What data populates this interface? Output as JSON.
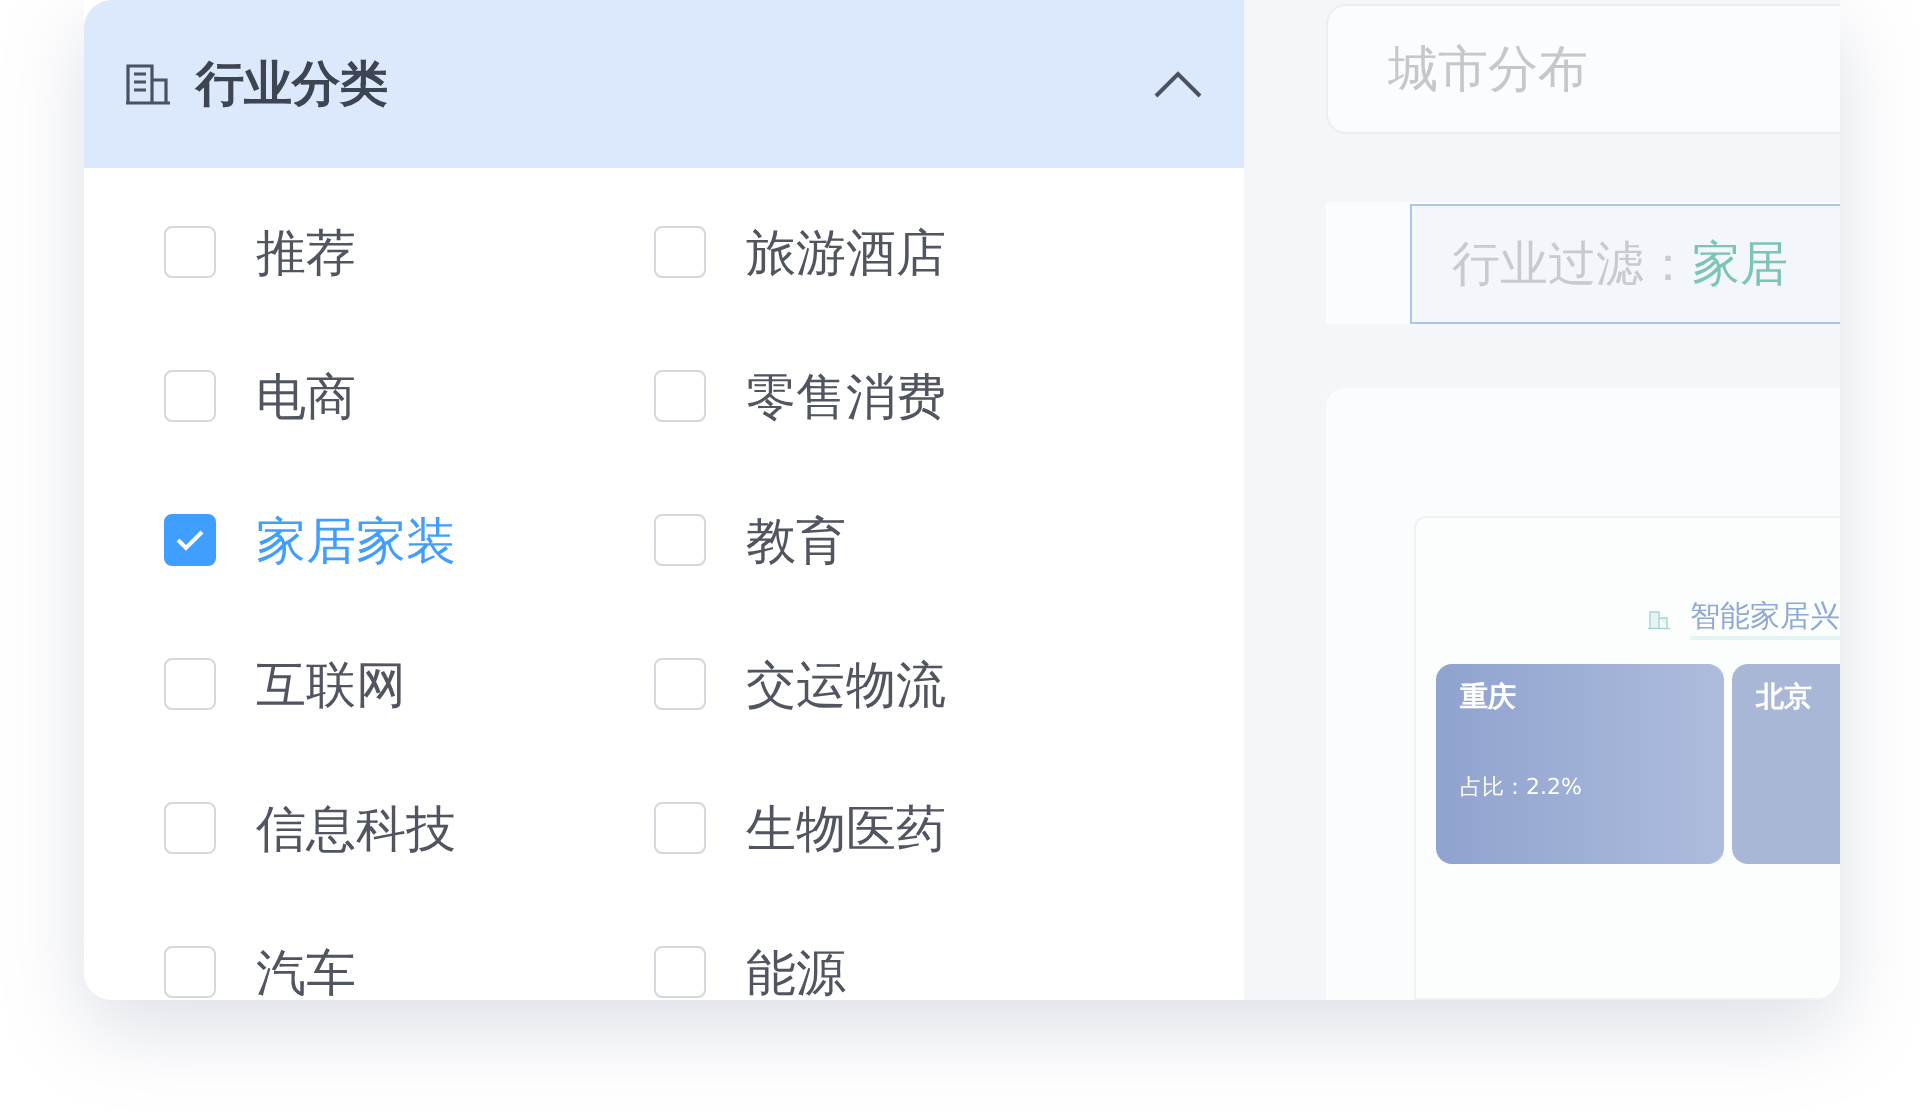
{
  "category_panel": {
    "title": "行业分类",
    "expanded": true,
    "options": [
      {
        "label": "推荐",
        "checked": false
      },
      {
        "label": "旅游酒店",
        "checked": false
      },
      {
        "label": "电商",
        "checked": false
      },
      {
        "label": "零售消费",
        "checked": false
      },
      {
        "label": "家居家装",
        "checked": true
      },
      {
        "label": "教育",
        "checked": false
      },
      {
        "label": "互联网",
        "checked": false
      },
      {
        "label": "交运物流",
        "checked": false
      },
      {
        "label": "信息科技",
        "checked": false
      },
      {
        "label": "生物医药",
        "checked": false
      },
      {
        "label": "汽车",
        "checked": false
      },
      {
        "label": "能源",
        "checked": false
      }
    ]
  },
  "city_card": {
    "title": "城市分布"
  },
  "filter": {
    "label": "行业过滤：",
    "value": "家居"
  },
  "insight_card": {
    "title": "智能家居兴",
    "tiles": [
      {
        "city": "重庆",
        "share": "占比：2.2%"
      },
      {
        "city": "北京"
      }
    ]
  }
}
